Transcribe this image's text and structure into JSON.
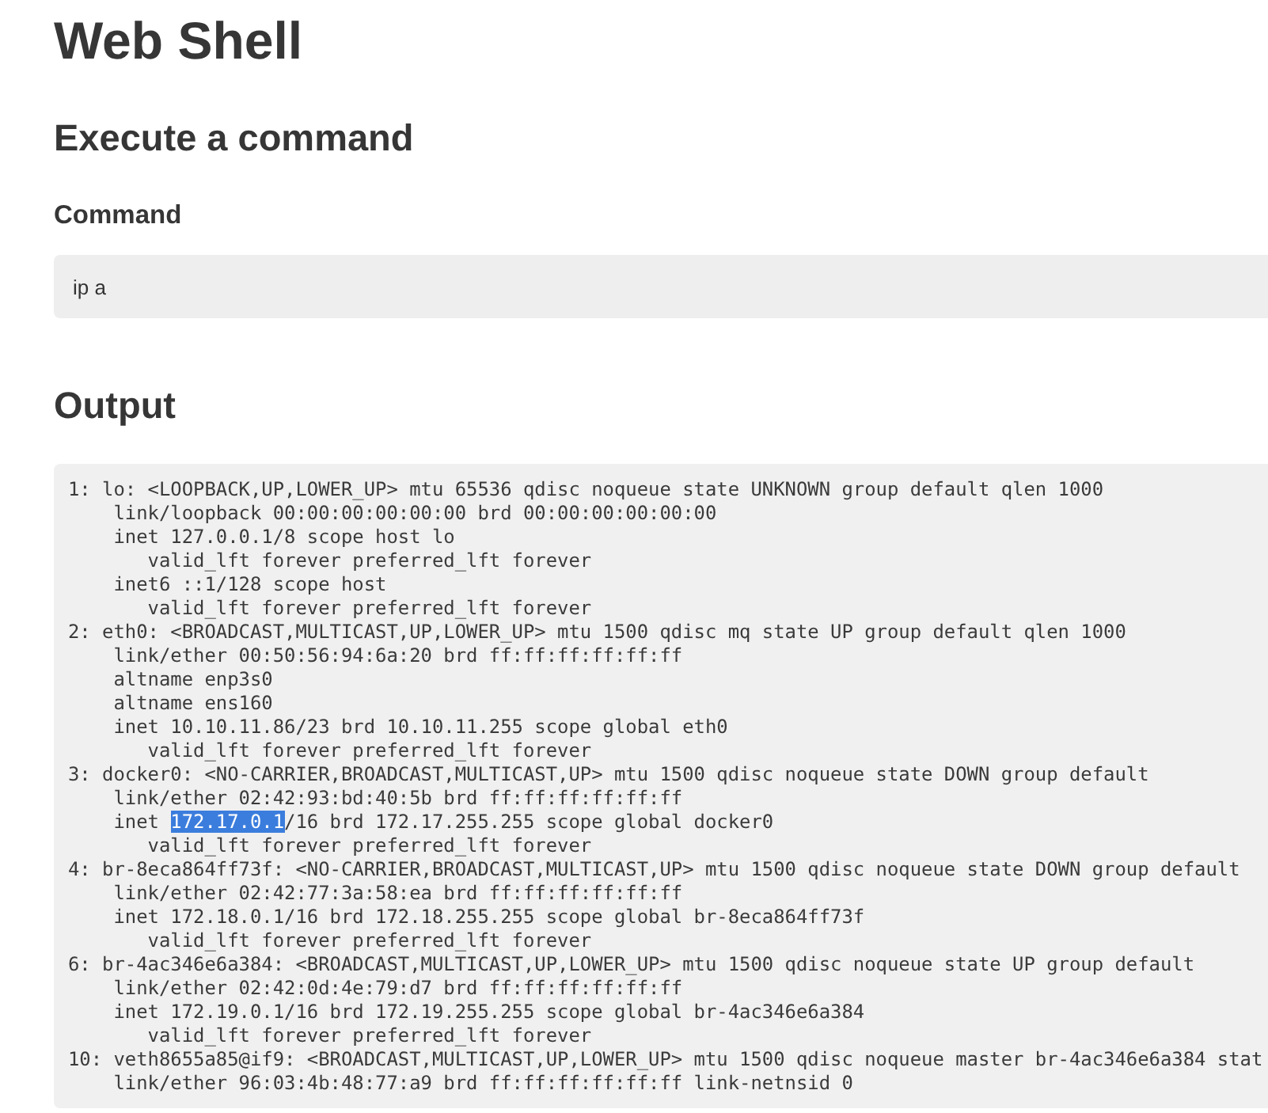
{
  "page": {
    "title": "Web Shell"
  },
  "command_section": {
    "heading": "Execute a command",
    "field": {
      "label": "Command",
      "value": "ip a"
    }
  },
  "output_section": {
    "heading": "Output",
    "lines": [
      {
        "parts": [
          {
            "text": "1: lo: <LOOPBACK,UP,LOWER_UP> mtu 65536 qdisc noqueue state UNKNOWN group default qlen 1000",
            "selected": false
          }
        ],
        "children": [
          {
            "parts": [
              {
                "text": "link/loopback 00:00:00:00:00:00 brd 00:00:00:00:00:00",
                "selected": false
              }
            ]
          },
          {
            "parts": [
              {
                "text": "inet 127.0.0.1/8 scope host lo",
                "selected": false
              }
            ],
            "children": [
              {
                "parts": [
                  {
                    "text": "valid_lft forever preferred_lft forever",
                    "selected": false
                  }
                ]
              }
            ]
          },
          {
            "parts": [
              {
                "text": "inet6 ::1/128 scope host",
                "selected": false
              }
            ],
            "children": [
              {
                "parts": [
                  {
                    "text": "valid_lft forever preferred_lft forever",
                    "selected": false
                  }
                ]
              }
            ]
          }
        ]
      },
      {
        "parts": [
          {
            "text": "2: eth0: <BROADCAST,MULTICAST,UP,LOWER_UP> mtu 1500 qdisc mq state UP group default qlen 1000",
            "selected": false
          }
        ],
        "children": [
          {
            "parts": [
              {
                "text": "link/ether 00:50:56:94:6a:20 brd ff:ff:ff:ff:ff:ff",
                "selected": false
              }
            ]
          },
          {
            "parts": [
              {
                "text": "altname enp3s0",
                "selected": false
              }
            ]
          },
          {
            "parts": [
              {
                "text": "altname ens160",
                "selected": false
              }
            ]
          },
          {
            "parts": [
              {
                "text": "inet 10.10.11.86/23 brd 10.10.11.255 scope global eth0",
                "selected": false
              }
            ],
            "children": [
              {
                "parts": [
                  {
                    "text": "valid_lft forever preferred_lft forever",
                    "selected": false
                  }
                ]
              }
            ]
          }
        ]
      },
      {
        "parts": [
          {
            "text": "3: docker0: <NO-CARRIER,BROADCAST,MULTICAST,UP> mtu 1500 qdisc noqueue state DOWN group default",
            "selected": false
          }
        ],
        "children": [
          {
            "parts": [
              {
                "text": "link/ether 02:42:93:bd:40:5b brd ff:ff:ff:ff:ff:ff",
                "selected": false
              }
            ]
          },
          {
            "parts": [
              {
                "text": "inet ",
                "selected": false
              },
              {
                "text": "172.17.0.1",
                "selected": true
              },
              {
                "text": "/16 brd 172.17.255.255 scope global docker0",
                "selected": false
              }
            ],
            "children": [
              {
                "parts": [
                  {
                    "text": "valid_lft forever preferred_lft forever",
                    "selected": false
                  }
                ]
              }
            ]
          }
        ]
      },
      {
        "parts": [
          {
            "text": "4: br-8eca864ff73f: <NO-CARRIER,BROADCAST,MULTICAST,UP> mtu 1500 qdisc noqueue state DOWN group default",
            "selected": false
          }
        ],
        "children": [
          {
            "parts": [
              {
                "text": "link/ether 02:42:77:3a:58:ea brd ff:ff:ff:ff:ff:ff",
                "selected": false
              }
            ]
          },
          {
            "parts": [
              {
                "text": "inet 172.18.0.1/16 brd 172.18.255.255 scope global br-8eca864ff73f",
                "selected": false
              }
            ],
            "children": [
              {
                "parts": [
                  {
                    "text": "valid_lft forever preferred_lft forever",
                    "selected": false
                  }
                ]
              }
            ]
          }
        ]
      },
      {
        "parts": [
          {
            "text": "6: br-4ac346e6a384: <BROADCAST,MULTICAST,UP,LOWER_UP> mtu 1500 qdisc noqueue state UP group default",
            "selected": false
          }
        ],
        "children": [
          {
            "parts": [
              {
                "text": "link/ether 02:42:0d:4e:79:d7 brd ff:ff:ff:ff:ff:ff",
                "selected": false
              }
            ]
          },
          {
            "parts": [
              {
                "text": "inet 172.19.0.1/16 brd 172.19.255.255 scope global br-4ac346e6a384",
                "selected": false
              }
            ],
            "children": [
              {
                "parts": [
                  {
                    "text": "valid_lft forever preferred_lft forever",
                    "selected": false
                  }
                ]
              }
            ]
          }
        ]
      },
      {
        "parts": [
          {
            "text": "10: veth8655a85@if9: <BROADCAST,MULTICAST,UP,LOWER_UP> mtu 1500 qdisc noqueue master br-4ac346e6a384 stat",
            "selected": false
          }
        ],
        "children": [
          {
            "parts": [
              {
                "text": "link/ether 96:03:4b:48:77:a9 brd ff:ff:ff:ff:ff:ff link-netnsid 0",
                "selected": false
              }
            ]
          }
        ]
      }
    ]
  }
}
